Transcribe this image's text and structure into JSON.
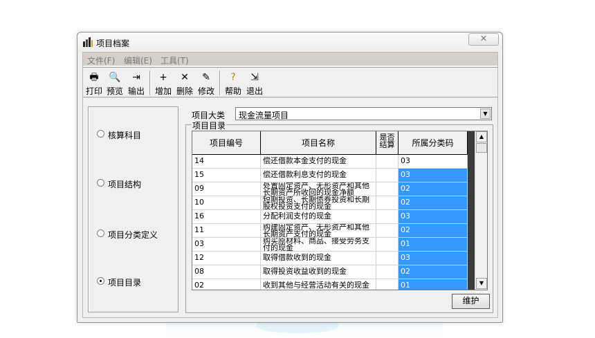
{
  "window": {
    "title": "项目档案",
    "close_glyph": "✕"
  },
  "menu": {
    "items": [
      "文件(F)",
      "编辑(E)",
      "工具(T)"
    ]
  },
  "toolbar": {
    "buttons": [
      {
        "label": "打印",
        "icon": "printer-icon",
        "glyph": "🖶"
      },
      {
        "label": "预览",
        "icon": "preview-icon",
        "glyph": "🔍"
      },
      {
        "label": "输出",
        "icon": "export-icon",
        "glyph": "⇥"
      },
      {
        "label": "增加",
        "icon": "add-icon",
        "glyph": "+"
      },
      {
        "label": "删除",
        "icon": "delete-icon",
        "glyph": "✕"
      },
      {
        "label": "修改",
        "icon": "edit-icon",
        "glyph": "✎"
      },
      {
        "label": "帮助",
        "icon": "help-icon",
        "glyph": "?"
      },
      {
        "label": "退出",
        "icon": "exit-icon",
        "glyph": "⇲"
      }
    ]
  },
  "left_panel": {
    "options": [
      {
        "label": "核算科目",
        "checked": false
      },
      {
        "label": "项目结构",
        "checked": false
      },
      {
        "label": "项目分类定义",
        "checked": false
      },
      {
        "label": "项目目录",
        "checked": true
      }
    ]
  },
  "category": {
    "label": "项目大类",
    "value": "现金流量项目"
  },
  "catalog": {
    "legend": "项目目录",
    "headers": [
      "项目编号",
      "项目名称",
      "是否结算",
      "所属分类码"
    ],
    "rows": [
      {
        "code": "14",
        "name": "偿还借款本金支付的现金",
        "settled": "",
        "class_code": "03"
      },
      {
        "code": "15",
        "name": "偿还借款利息支付的现金",
        "settled": "",
        "class_code": "03"
      },
      {
        "code": "09",
        "name": "处置固定资产、无形资产和其他长期资产所收回的现金净额",
        "settled": "",
        "class_code": "02"
      },
      {
        "code": "10",
        "name": "短期投资、长期债券投资和长期股权投资支付的现金",
        "settled": "",
        "class_code": "02"
      },
      {
        "code": "16",
        "name": "分配利润支付的现金",
        "settled": "",
        "class_code": "03"
      },
      {
        "code": "11",
        "name": "购建固定资产、无形资产和其他长期资产支付的现金",
        "settled": "",
        "class_code": "02"
      },
      {
        "code": "03",
        "name": "购买原材料、商品、接受劳务支付的现金",
        "settled": "",
        "class_code": "01"
      },
      {
        "code": "12",
        "name": "取得借款收到的现金",
        "settled": "",
        "class_code": "03"
      },
      {
        "code": "08",
        "name": "取得投资收益收到的现金",
        "settled": "",
        "class_code": "02"
      },
      {
        "code": "02",
        "name": "收到其他与经营活动有关的现金",
        "settled": "",
        "class_code": "01"
      }
    ]
  },
  "actions": {
    "maintain_label": "维护"
  },
  "colors": {
    "selection": "#3399ff"
  }
}
